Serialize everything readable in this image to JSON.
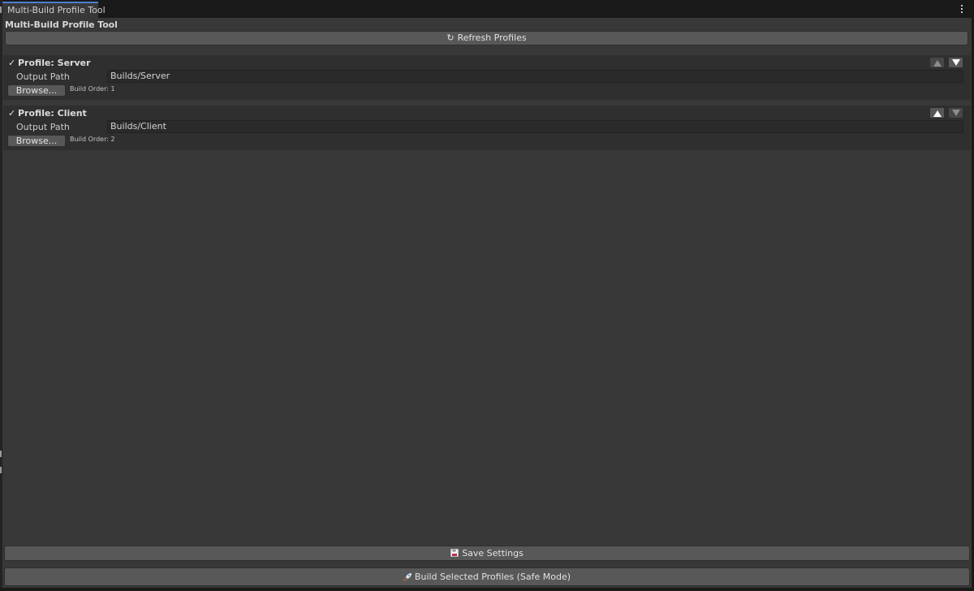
{
  "window": {
    "tab_title": "Multi-Build Profile Tool",
    "panel_title": "Multi-Build Profile Tool"
  },
  "toolbar": {
    "refresh_label": "Refresh Profiles",
    "refresh_icon": "refresh-icon"
  },
  "profiles": [
    {
      "name": "Profile: Server",
      "checked": true,
      "output_label": "Output Path",
      "output_value": "Builds/Server",
      "browse_label": "Browse...",
      "build_order": "Build Order: 1",
      "move_up_enabled": false,
      "move_down_enabled": true
    },
    {
      "name": "Profile: Client",
      "checked": true,
      "output_label": "Output Path",
      "output_value": "Builds/Client",
      "browse_label": "Browse...",
      "build_order": "Build Order: 2",
      "move_up_enabled": true,
      "move_down_enabled": false
    }
  ],
  "footer": {
    "save_label": "Save Settings",
    "save_icon": "floppy-disk-icon",
    "build_label": "Build Selected Profiles (Safe Mode)",
    "build_icon": "rocket-icon"
  },
  "colors": {
    "panel_bg": "#383838",
    "button_bg": "#585858",
    "tab_accent": "#4c7fd2",
    "profile_box_bg": "#2f2f2f"
  }
}
